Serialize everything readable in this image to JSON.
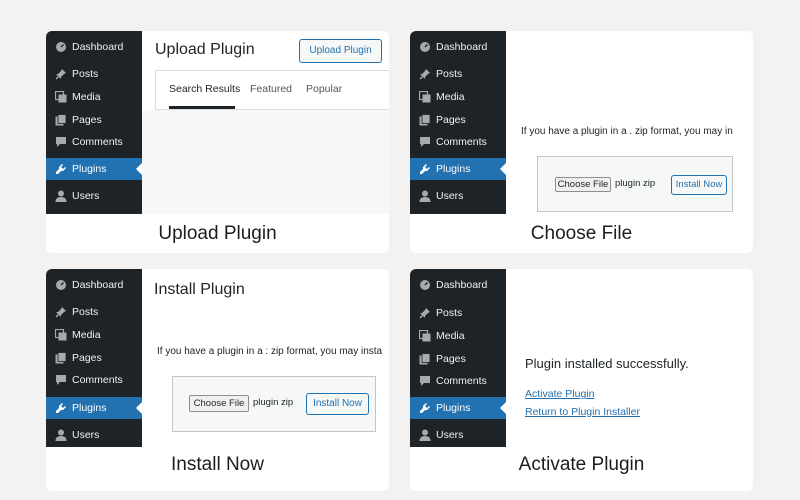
{
  "sidebar": {
    "items": [
      {
        "label": "Dashboard",
        "icon": "dashboard-icon"
      },
      {
        "label": "Posts",
        "icon": "pin-icon"
      },
      {
        "label": "Media",
        "icon": "media-icon"
      },
      {
        "label": "Pages",
        "icon": "pages-icon"
      },
      {
        "label": "Comments",
        "icon": "comment-icon"
      },
      {
        "label": "Plugins",
        "icon": "plugin-icon"
      },
      {
        "label": "Users",
        "icon": "user-icon"
      }
    ],
    "active": "Plugins",
    "colors": {
      "background": "#1d2327",
      "active": "#2271b1"
    }
  },
  "panels": [
    {
      "caption": "Upload Plugin",
      "title": "Upload Plugin",
      "upload_button": "Upload Plugin",
      "tabs": [
        "Search Results",
        "Featured",
        "Popular"
      ]
    },
    {
      "caption": "Choose File",
      "instruction": "If you have a plugin in a . zip format, you may in",
      "choose_file": "Choose File",
      "file_name": "plugin zip",
      "install_button": "Install Now"
    },
    {
      "caption": "Install Now",
      "title": "Install Plugin",
      "instruction": "If you have a plugin in a : zip format, you may insta",
      "choose_file": "Choose File",
      "file_name": "plugin zip",
      "install_button": "Install Now"
    },
    {
      "caption": "Activate Plugin",
      "message": "Plugin installed successfully.",
      "links": [
        "Activate Plugin",
        "Return to Plugin Installer"
      ]
    }
  ]
}
